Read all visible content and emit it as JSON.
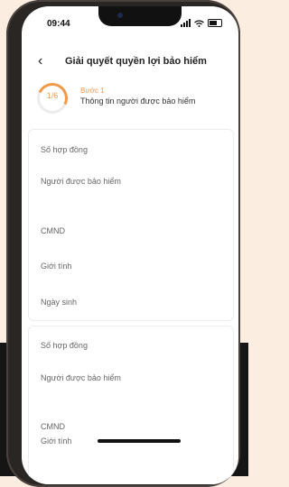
{
  "status_bar": {
    "time": "09:44"
  },
  "header": {
    "back": "‹",
    "title": "Giải quyết quyền lợi bảo hiểm"
  },
  "step": {
    "progress": "1/6",
    "progress_fraction": 0.1667,
    "name": "Bước 1",
    "description": "Thông tin người được bảo hiểm"
  },
  "cards": [
    {
      "fields": [
        "Số hợp đồng",
        "Người được bảo hiểm",
        "CMND",
        "Giới tính",
        "Ngày sinh"
      ]
    },
    {
      "fields": [
        "Số hợp đồng",
        "Người được bảo hiểm",
        "CMND",
        "Giới tính"
      ]
    }
  ],
  "colors": {
    "accent": "#f2994a",
    "background": "#fbeee0"
  }
}
